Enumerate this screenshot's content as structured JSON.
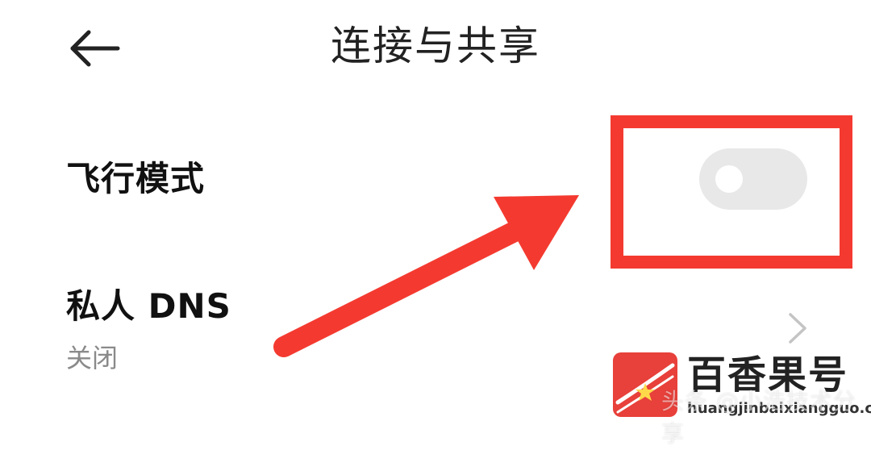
{
  "header": {
    "back_icon": "arrow-left-icon",
    "title": "连接与共享"
  },
  "settings": {
    "airplane_mode": {
      "label": "飞行模式",
      "toggle_state": "off"
    },
    "private_dns": {
      "label": "私人 DNS",
      "value": "关闭",
      "chevron_icon": "chevron-right-icon"
    }
  },
  "annotation": {
    "color": "#f43a30"
  },
  "watermark": {
    "name": "百香果号",
    "domain": "huangjinbaixiangguo.com",
    "overlay_text": "头条 @小浩技术分享"
  }
}
